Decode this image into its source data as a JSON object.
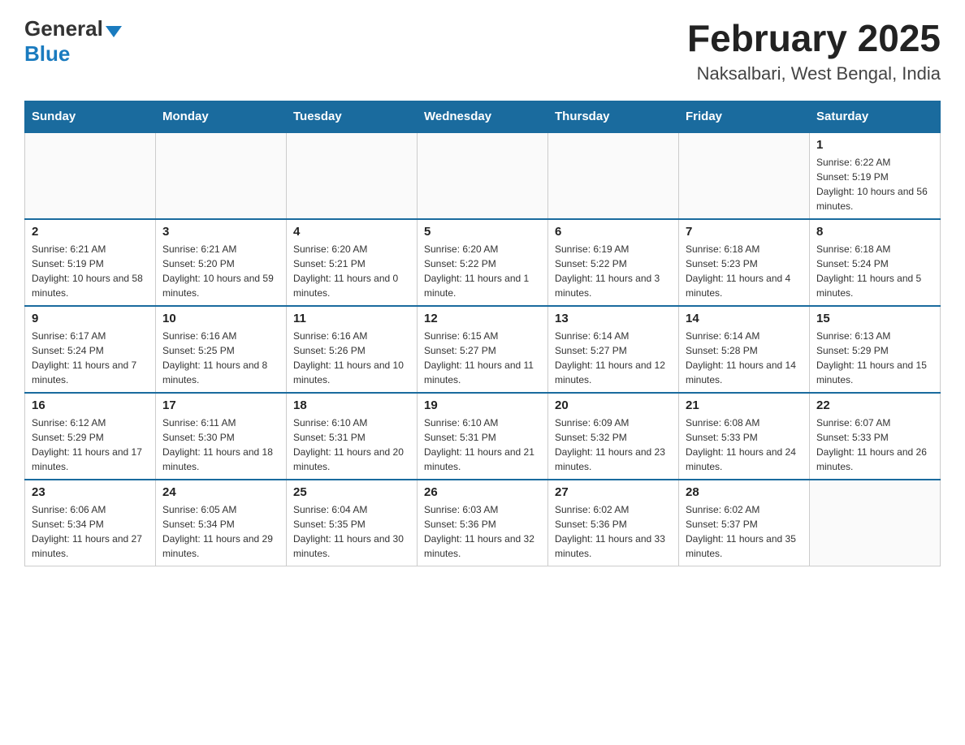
{
  "header": {
    "logo_general": "General",
    "logo_blue": "Blue",
    "month_title": "February 2025",
    "location": "Naksalbari, West Bengal, India"
  },
  "days_of_week": [
    "Sunday",
    "Monday",
    "Tuesday",
    "Wednesday",
    "Thursday",
    "Friday",
    "Saturday"
  ],
  "weeks": [
    [
      {
        "day": "",
        "info": ""
      },
      {
        "day": "",
        "info": ""
      },
      {
        "day": "",
        "info": ""
      },
      {
        "day": "",
        "info": ""
      },
      {
        "day": "",
        "info": ""
      },
      {
        "day": "",
        "info": ""
      },
      {
        "day": "1",
        "info": "Sunrise: 6:22 AM\nSunset: 5:19 PM\nDaylight: 10 hours and 56 minutes."
      }
    ],
    [
      {
        "day": "2",
        "info": "Sunrise: 6:21 AM\nSunset: 5:19 PM\nDaylight: 10 hours and 58 minutes."
      },
      {
        "day": "3",
        "info": "Sunrise: 6:21 AM\nSunset: 5:20 PM\nDaylight: 10 hours and 59 minutes."
      },
      {
        "day": "4",
        "info": "Sunrise: 6:20 AM\nSunset: 5:21 PM\nDaylight: 11 hours and 0 minutes."
      },
      {
        "day": "5",
        "info": "Sunrise: 6:20 AM\nSunset: 5:22 PM\nDaylight: 11 hours and 1 minute."
      },
      {
        "day": "6",
        "info": "Sunrise: 6:19 AM\nSunset: 5:22 PM\nDaylight: 11 hours and 3 minutes."
      },
      {
        "day": "7",
        "info": "Sunrise: 6:18 AM\nSunset: 5:23 PM\nDaylight: 11 hours and 4 minutes."
      },
      {
        "day": "8",
        "info": "Sunrise: 6:18 AM\nSunset: 5:24 PM\nDaylight: 11 hours and 5 minutes."
      }
    ],
    [
      {
        "day": "9",
        "info": "Sunrise: 6:17 AM\nSunset: 5:24 PM\nDaylight: 11 hours and 7 minutes."
      },
      {
        "day": "10",
        "info": "Sunrise: 6:16 AM\nSunset: 5:25 PM\nDaylight: 11 hours and 8 minutes."
      },
      {
        "day": "11",
        "info": "Sunrise: 6:16 AM\nSunset: 5:26 PM\nDaylight: 11 hours and 10 minutes."
      },
      {
        "day": "12",
        "info": "Sunrise: 6:15 AM\nSunset: 5:27 PM\nDaylight: 11 hours and 11 minutes."
      },
      {
        "day": "13",
        "info": "Sunrise: 6:14 AM\nSunset: 5:27 PM\nDaylight: 11 hours and 12 minutes."
      },
      {
        "day": "14",
        "info": "Sunrise: 6:14 AM\nSunset: 5:28 PM\nDaylight: 11 hours and 14 minutes."
      },
      {
        "day": "15",
        "info": "Sunrise: 6:13 AM\nSunset: 5:29 PM\nDaylight: 11 hours and 15 minutes."
      }
    ],
    [
      {
        "day": "16",
        "info": "Sunrise: 6:12 AM\nSunset: 5:29 PM\nDaylight: 11 hours and 17 minutes."
      },
      {
        "day": "17",
        "info": "Sunrise: 6:11 AM\nSunset: 5:30 PM\nDaylight: 11 hours and 18 minutes."
      },
      {
        "day": "18",
        "info": "Sunrise: 6:10 AM\nSunset: 5:31 PM\nDaylight: 11 hours and 20 minutes."
      },
      {
        "day": "19",
        "info": "Sunrise: 6:10 AM\nSunset: 5:31 PM\nDaylight: 11 hours and 21 minutes."
      },
      {
        "day": "20",
        "info": "Sunrise: 6:09 AM\nSunset: 5:32 PM\nDaylight: 11 hours and 23 minutes."
      },
      {
        "day": "21",
        "info": "Sunrise: 6:08 AM\nSunset: 5:33 PM\nDaylight: 11 hours and 24 minutes."
      },
      {
        "day": "22",
        "info": "Sunrise: 6:07 AM\nSunset: 5:33 PM\nDaylight: 11 hours and 26 minutes."
      }
    ],
    [
      {
        "day": "23",
        "info": "Sunrise: 6:06 AM\nSunset: 5:34 PM\nDaylight: 11 hours and 27 minutes."
      },
      {
        "day": "24",
        "info": "Sunrise: 6:05 AM\nSunset: 5:34 PM\nDaylight: 11 hours and 29 minutes."
      },
      {
        "day": "25",
        "info": "Sunrise: 6:04 AM\nSunset: 5:35 PM\nDaylight: 11 hours and 30 minutes."
      },
      {
        "day": "26",
        "info": "Sunrise: 6:03 AM\nSunset: 5:36 PM\nDaylight: 11 hours and 32 minutes."
      },
      {
        "day": "27",
        "info": "Sunrise: 6:02 AM\nSunset: 5:36 PM\nDaylight: 11 hours and 33 minutes."
      },
      {
        "day": "28",
        "info": "Sunrise: 6:02 AM\nSunset: 5:37 PM\nDaylight: 11 hours and 35 minutes."
      },
      {
        "day": "",
        "info": ""
      }
    ]
  ]
}
